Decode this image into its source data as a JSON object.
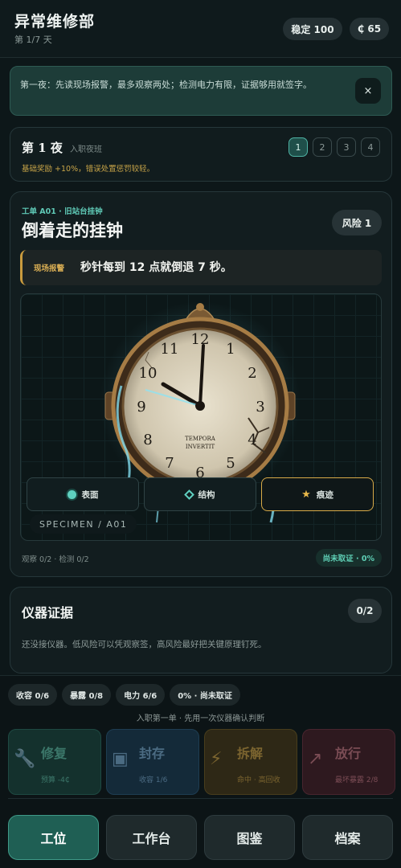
{
  "header": {
    "title": "异常维修部",
    "day": "第 1/7 天",
    "stability": "稳定 100",
    "credits": "₵ 65"
  },
  "notice": {
    "text": "第一夜：先读现场报警，最多观察两处；检测电力有限，证据够用就签字。",
    "close": "×"
  },
  "night": {
    "title": "第 1 夜",
    "subtitle": "入职夜班",
    "bonus": "基础奖励 +10%，错误处置惩罚较轻。",
    "pages": [
      "1",
      "2",
      "3",
      "4"
    ],
    "active_page": "1"
  },
  "order": {
    "tag": "工单 A01 · 旧站台挂钟",
    "title": "倒着走的挂钟",
    "risk": "风险 1",
    "report_label": "现场报警",
    "report_text": "秒针每到 12 点就倒退 7 秒。",
    "clock_inscription_1": "TEMPORA",
    "clock_inscription_2": "INVERTIT",
    "views": [
      {
        "label": "表面",
        "icon": "circle-icon"
      },
      {
        "label": "结构",
        "icon": "diamond-icon"
      },
      {
        "label": "痕迹",
        "icon": "star-icon"
      }
    ],
    "specimen_label": "SPECIMEN / A01",
    "meta": "观察 0/2 · 检测 0/2",
    "evidence_status": "尚未取证 · 0%"
  },
  "evidence": {
    "title": "仪器证据",
    "count": "0/2",
    "hint": "还没接仪器。低风险可以凭观察签，高风险最好把关键原理钉死。"
  },
  "bottom": {
    "stats": [
      "收容 0/6",
      "暴露 0/8",
      "电力 6/6",
      "0% · 尚未取证"
    ],
    "hint": "入职第一单 · 先用一次仪器确认判断",
    "actions": [
      {
        "title": "修复",
        "sub": "预算 -4₵",
        "icon": "wrench-icon",
        "glyph": "🔧"
      },
      {
        "title": "封存",
        "sub": "收容 1/6",
        "icon": "container-icon",
        "glyph": "▣"
      },
      {
        "title": "拆解",
        "sub": "命中 · 高回收",
        "icon": "lightning-icon",
        "glyph": "⚡"
      },
      {
        "title": "放行",
        "sub": "最坏暴露 2/8",
        "icon": "arrow-icon",
        "glyph": "↗"
      }
    ]
  },
  "tabs": [
    "工位",
    "工作台",
    "图鉴",
    "档案"
  ],
  "colors": {
    "accent": "#4fb3a4",
    "warning": "#d8aa48",
    "background": "#0d1719"
  }
}
